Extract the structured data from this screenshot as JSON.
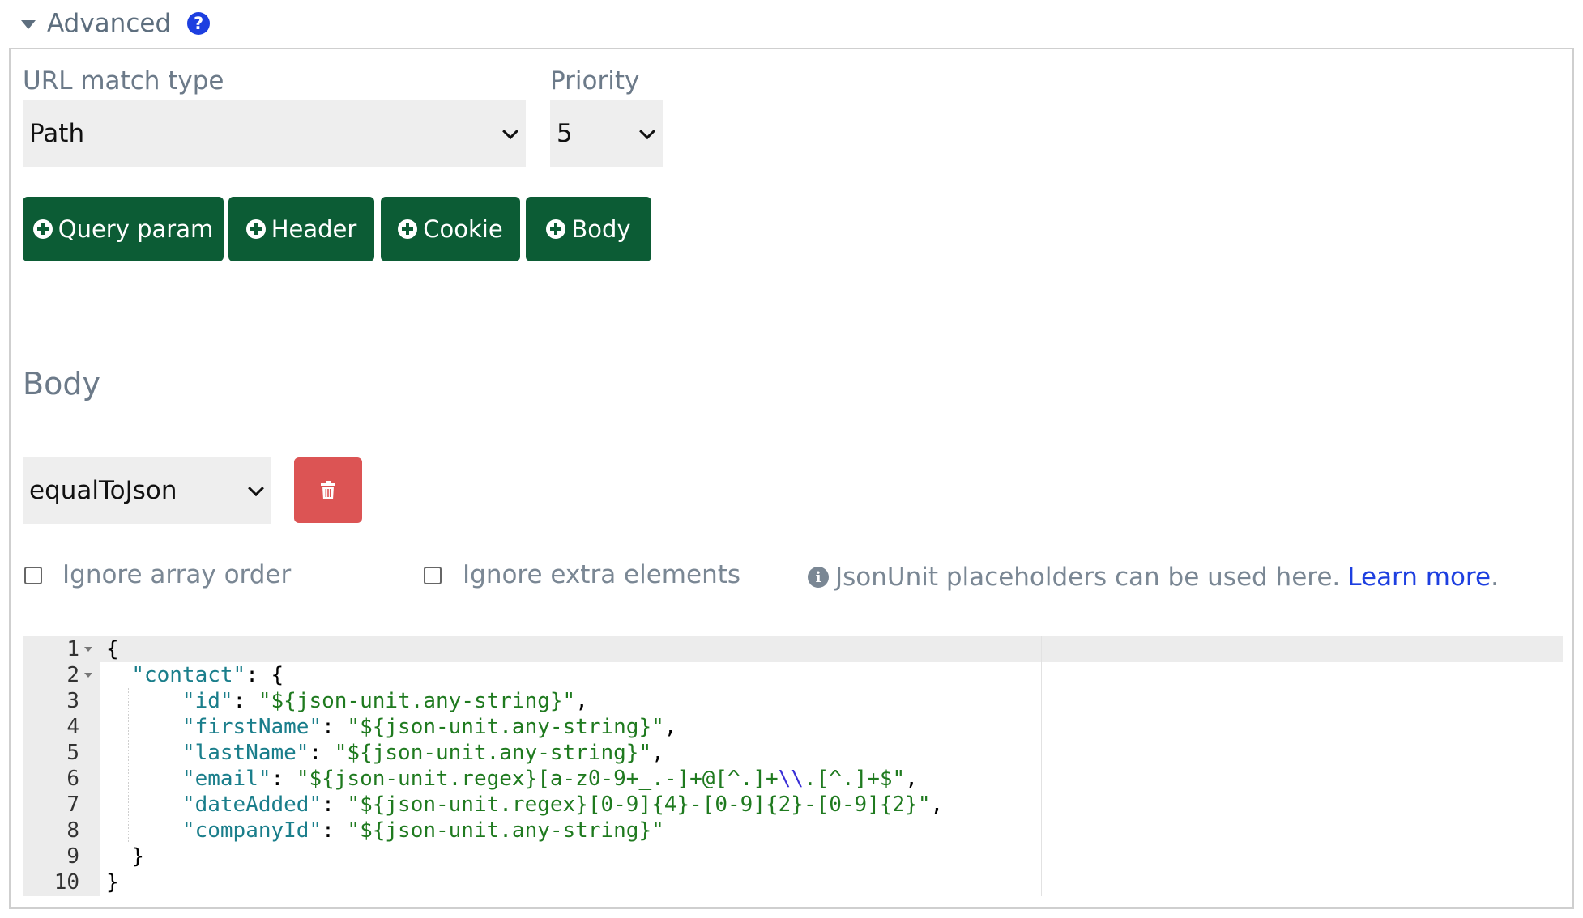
{
  "advanced": {
    "title": "Advanced",
    "help_icon": "?"
  },
  "url_match": {
    "label": "URL match type",
    "selected": "Path"
  },
  "priority": {
    "label": "Priority",
    "selected": "5"
  },
  "add_buttons": [
    {
      "label": "Query param"
    },
    {
      "label": "Header"
    },
    {
      "label": "Cookie"
    },
    {
      "label": "Body"
    }
  ],
  "body_section": {
    "title": "Body",
    "matcher_selected": "equalToJson"
  },
  "options": {
    "ignore_array_order": {
      "label": "Ignore array order",
      "checked": false
    },
    "ignore_extra_elements": {
      "label": "Ignore extra elements",
      "checked": false
    }
  },
  "info": {
    "text": "JsonUnit placeholders can be used here.",
    "link": "Learn more",
    "period": "."
  },
  "editor": {
    "lines": [
      "1",
      "2",
      "3",
      "4",
      "5",
      "6",
      "7",
      "8",
      "9",
      "10"
    ]
  },
  "colors": {
    "green_button": "#0c5c35",
    "delete_button": "#dc5454",
    "link_blue": "#1d3fe0",
    "json_key": "#1a7e8b",
    "json_string": "#1f7a1f"
  },
  "icons": {
    "toggle": "caret-down-icon",
    "help": "question-circle-icon",
    "add": "plus-circle-icon",
    "delete": "trash-icon",
    "info": "info-circle-icon"
  }
}
